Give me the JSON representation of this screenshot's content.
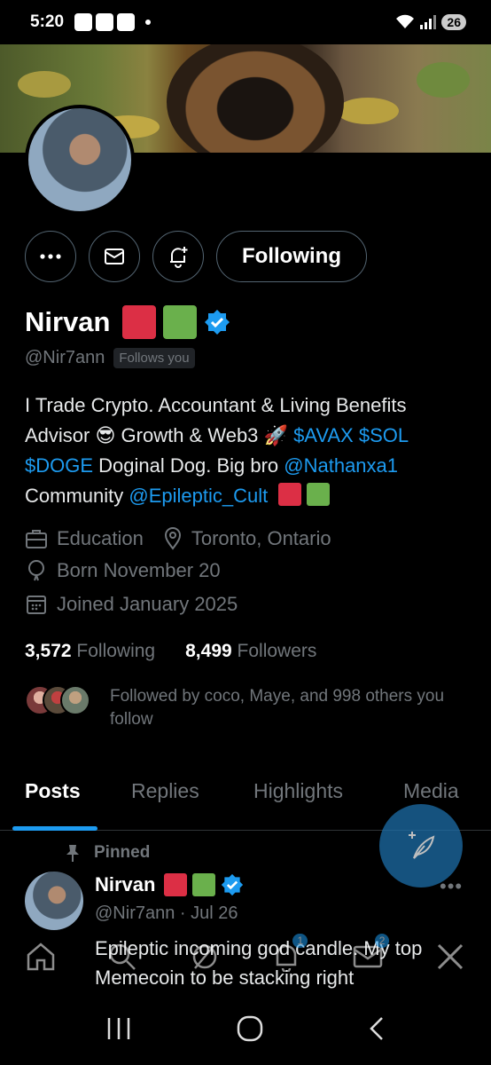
{
  "status_bar": {
    "time": "5:20",
    "battery": "26"
  },
  "profile": {
    "name": "Nirvan",
    "handle": "@Nir7ann",
    "follows_you": "Follows you",
    "following_button": "Following",
    "bio": {
      "line1": "I Trade Crypto. Accountant & Living Benefits",
      "advisor": "Advisor",
      "emoji_cool": "😎",
      "growth": " Growth & Web3 ",
      "emoji_rocket": "🚀",
      "avax": "$AVAX",
      "sol": "$SOL",
      "doge": "$DOGE",
      "doginal": " Doginal Dog. Big bro ",
      "nathan": "@Nathanxa1",
      "community": "Community ",
      "cult": "@Epileptic_Cult"
    },
    "category": "Education",
    "location": "Toronto, Ontario",
    "born": "Born November 20",
    "joined": "Joined January 2025",
    "following_count": "3,572",
    "following_label": "Following",
    "followers_count": "8,499",
    "followers_label": "Followers",
    "followed_by": "Followed by coco, Maye, and 998 others you follow"
  },
  "tabs": [
    "Posts",
    "Replies",
    "Highlights",
    "Media"
  ],
  "post": {
    "pinned": "Pinned",
    "name": "Nirvan",
    "handle_date": "@Nir7ann · Jul 26",
    "text": "Epileptic incoming god candle. My top Memecoin to be stacking right"
  },
  "nav_badges": {
    "notifications": "1",
    "messages": "2"
  },
  "colors": {
    "accent": "#1d9bf0",
    "red_square": "#dc2f45",
    "green_square": "#6ab04c"
  }
}
